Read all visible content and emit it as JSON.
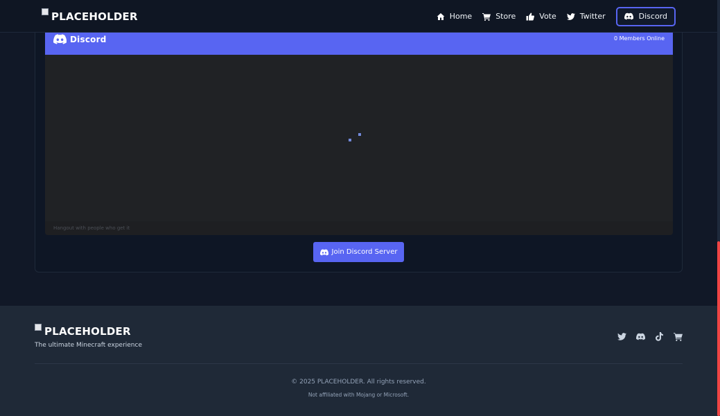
{
  "nav": {
    "brand": "PLACEHOLDER",
    "links": [
      {
        "label": "Home",
        "icon": "home-icon"
      },
      {
        "label": "Store",
        "icon": "cart-icon"
      },
      {
        "label": "Vote",
        "icon": "thumbs-up-icon"
      },
      {
        "label": "Twitter",
        "icon": "twitter-icon"
      }
    ],
    "discord_label": "Discord"
  },
  "widget": {
    "title": "Discord",
    "members_online": "0 Members Online",
    "footer_text": "Hangout with people who get it",
    "brand_color": "#5865f2"
  },
  "join_button": {
    "label": "Join Discord Server"
  },
  "footer": {
    "brand": "PLACEHOLDER",
    "tagline": "The ultimate Minecraft experience",
    "socials": [
      "twitter-icon",
      "discord-icon",
      "tiktok-icon",
      "cart-icon"
    ],
    "copyright": "© 2025 PLACEHOLDER. All rights reserved.",
    "disclaimer": "Not affiliated with Mojang or Microsoft."
  },
  "colors": {
    "accent": "#5865f2",
    "scroll_thumb": "#ef4444"
  }
}
